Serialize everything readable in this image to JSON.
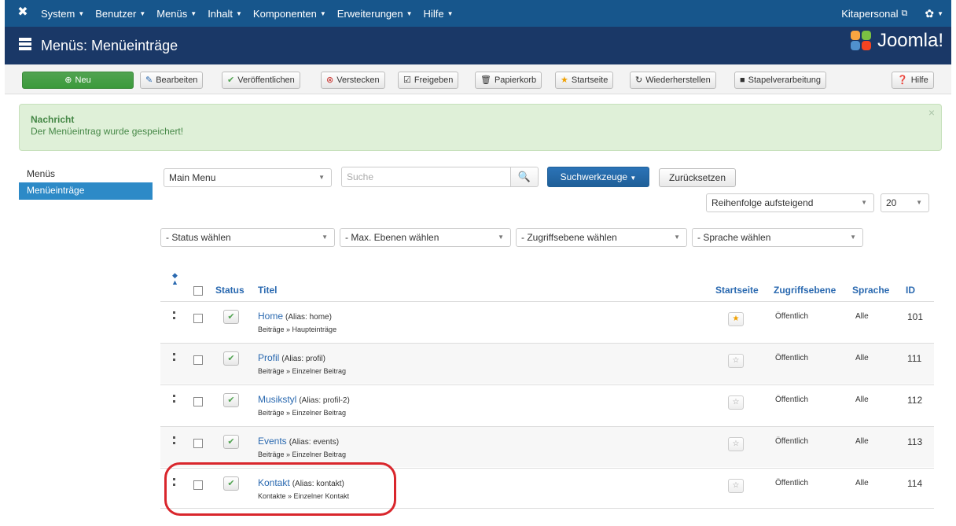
{
  "navbar": {
    "menus": [
      "System",
      "Benutzer",
      "Menüs",
      "Inhalt",
      "Komponenten",
      "Erweiterungen",
      "Hilfe"
    ],
    "site_link": "Kitapersonal",
    "brand_icon": "joomla-x-icon",
    "settings_icon": "gear-icon"
  },
  "header": {
    "title": "Menüs: Menüeinträge",
    "logo_text": "Joomla!"
  },
  "toolbar": {
    "new": "Neu",
    "edit": "Bearbeiten",
    "publish": "Veröffentlichen",
    "unpublish": "Verstecken",
    "checkin": "Freigeben",
    "trash": "Papierkorb",
    "home": "Startseite",
    "rebuild": "Wiederherstellen",
    "batch": "Stapelverarbeitung",
    "help": "Hilfe"
  },
  "message": {
    "heading": "Nachricht",
    "text": "Der Menüeintrag wurde gespeichert!",
    "close": "×"
  },
  "sidebar": {
    "items": [
      "Menüs",
      "Menüeinträge"
    ]
  },
  "filters": {
    "menu_select": "Main Menu",
    "search_placeholder": "Suche",
    "search_tools": "Suchwerkzeuge",
    "reset": "Zurücksetzen",
    "ordering": "Reihenfolge aufsteigend",
    "limit": "20",
    "status": "- Status wählen",
    "levels": "- Max. Ebenen wählen",
    "access": "- Zugriffsebene wählen",
    "language": "- Sprache wählen"
  },
  "table": {
    "headers": {
      "status": "Status",
      "title": "Titel",
      "home": "Startseite",
      "access": "Zugriffsebene",
      "language": "Sprache",
      "id": "ID"
    },
    "rows": [
      {
        "title": "Home",
        "alias": "(Alias: home)",
        "sub": "Beiträge » Haupteinträge",
        "home": true,
        "access": "Öffentlich",
        "language": "Alle",
        "id": "101"
      },
      {
        "title": "Profil",
        "alias": "(Alias: profil)",
        "sub": "Beiträge » Einzelner Beitrag",
        "home": false,
        "access": "Öffentlich",
        "language": "Alle",
        "id": "111"
      },
      {
        "title": "Musikstyl",
        "alias": "(Alias: profil-2)",
        "sub": "Beiträge » Einzelner Beitrag",
        "home": false,
        "access": "Öffentlich",
        "language": "Alle",
        "id": "112"
      },
      {
        "title": "Events",
        "alias": "(Alias: events)",
        "sub": "Beiträge » Einzelner Beitrag",
        "home": false,
        "access": "Öffentlich",
        "language": "Alle",
        "id": "113"
      },
      {
        "title": "Kontakt",
        "alias": "(Alias: kontakt)",
        "sub": "Kontakte » Einzelner Kontakt",
        "home": false,
        "access": "Öffentlich",
        "language": "Alle",
        "id": "114"
      }
    ]
  },
  "colors": {
    "navbar": "#17568c",
    "header": "#1a3867",
    "accent": "#2a69b0",
    "success": "#51a351",
    "highlight": "#d9262c"
  }
}
